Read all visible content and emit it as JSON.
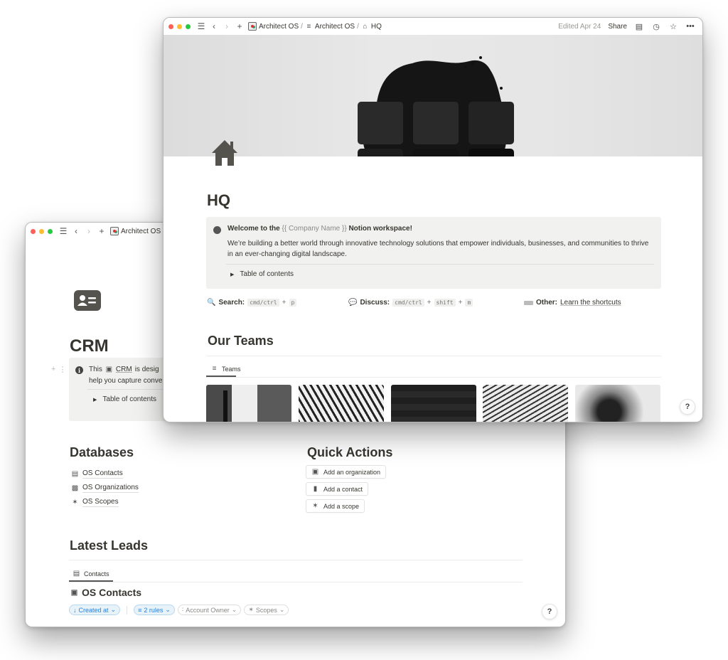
{
  "crm_window": {
    "titlebar": {
      "breadcrumb": [
        "Architect OS"
      ],
      "truncated_separator": "/"
    },
    "page": {
      "icon": "contact-card-icon",
      "title": "CRM",
      "callout": {
        "icon": "info-icon",
        "line1_prefix": "This",
        "line1_link": "CRM",
        "line1_suffix": "is desig",
        "line2": "help you capture conve",
        "toggle_label": "Table of contents"
      },
      "databases": {
        "heading": "Databases",
        "items": [
          {
            "icon": "contact-card-icon",
            "label": "OS Contacts"
          },
          {
            "icon": "buildings-icon",
            "label": "OS Organizations"
          },
          {
            "icon": "telescope-icon",
            "label": "OS Scopes"
          }
        ]
      },
      "quick_actions": {
        "heading": "Quick Actions",
        "buttons": [
          {
            "icon": "briefcase-icon",
            "label": "Add an organization"
          },
          {
            "icon": "contact-book-icon",
            "label": "Add a contact"
          },
          {
            "icon": "telescope-icon",
            "label": "Add a scope"
          }
        ]
      },
      "latest_leads": {
        "heading": "Latest Leads",
        "tab_label": "Contacts",
        "view_title": "OS Contacts",
        "filters": {
          "sort": "Created at",
          "rules": "2 rules",
          "account_owner": "Account Owner",
          "scopes": "Scopes"
        }
      },
      "help_label": "?"
    }
  },
  "hq_window": {
    "titlebar": {
      "breadcrumb": [
        "Architect OS",
        "Architect OS",
        "HQ"
      ],
      "edited": "Edited Apr 24",
      "share": "Share"
    },
    "page": {
      "title": "HQ",
      "callout": {
        "title_prefix": "Welcome to the",
        "placeholder": "{{ Company Name }}",
        "title_suffix": "Notion workspace!",
        "body": "We’re building a better world through innovative technology solutions that empower individuals, businesses, and communities to thrive in an ever-changing digital landscape.",
        "toggle_label": "Table of contents"
      },
      "shortcuts": {
        "search": {
          "label": "Search:",
          "keys": [
            "cmd/ctrl",
            "p"
          ]
        },
        "discuss": {
          "label": "Discuss:",
          "keys": [
            "cmd/ctrl",
            "shift",
            "m"
          ]
        },
        "other": {
          "label": "Other:",
          "link": "Learn the shortcuts"
        },
        "plus": "+"
      },
      "teams": {
        "heading": "Our Teams",
        "tab_label": "Teams",
        "cards": [
          {
            "image": "paper-and-figure"
          },
          {
            "image": "wave-facade"
          },
          {
            "image": "dark-cubes"
          },
          {
            "image": "curved-facade"
          },
          {
            "image": "chain-gears"
          }
        ]
      },
      "help_label": "?"
    }
  }
}
